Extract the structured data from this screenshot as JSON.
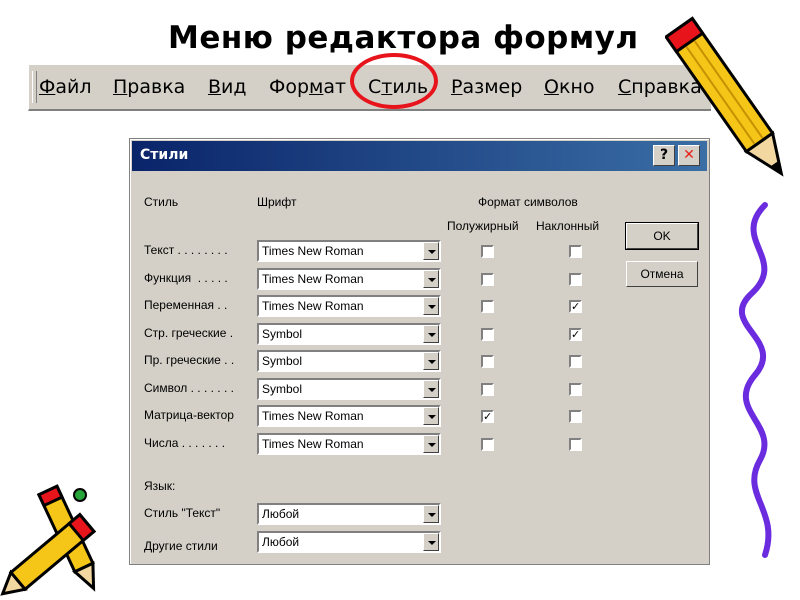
{
  "slide": {
    "title": "Меню редактора формул"
  },
  "menubar": {
    "items": [
      {
        "pre": "",
        "ul": "Ф",
        "post": "айл"
      },
      {
        "pre": "",
        "ul": "П",
        "post": "равка"
      },
      {
        "pre": "",
        "ul": "В",
        "post": "ид"
      },
      {
        "pre": "Фор",
        "ul": "м",
        "post": "ат"
      },
      {
        "pre": "С",
        "ul": "т",
        "post": "иль"
      },
      {
        "pre": "",
        "ul": "Р",
        "post": "азмер"
      },
      {
        "pre": "",
        "ul": "О",
        "post": "кно"
      },
      {
        "pre": "",
        "ul": "С",
        "post": "правка"
      }
    ],
    "highlight_color": "#e8141c"
  },
  "dialog": {
    "title": "Стили",
    "help_glyph": "?",
    "close_glyph": "✕",
    "headers": {
      "style": "Стиль",
      "font": "Шрифт",
      "char_format": "Формат символов",
      "bold": "Полужирный",
      "italic": "Наклонный"
    },
    "rows": [
      {
        "label": "Текст . . . . . . . .",
        "font": "Times New Roman",
        "bold": false,
        "italic": false
      },
      {
        "label": "Функция  . . . . .",
        "font": "Times New Roman",
        "bold": false,
        "italic": false
      },
      {
        "label": "Переменная . .",
        "font": "Times New Roman",
        "bold": false,
        "italic": true
      },
      {
        "label": "Стр. греческие .",
        "font": "Symbol",
        "bold": false,
        "italic": true
      },
      {
        "label": "Пр. греческие . .",
        "font": "Symbol",
        "bold": false,
        "italic": false
      },
      {
        "label": "Символ . . . . . . .",
        "font": "Symbol",
        "bold": false,
        "italic": false
      },
      {
        "label": "Матрица-вектор",
        "font": "Times New Roman",
        "bold": true,
        "italic": false
      },
      {
        "label": "Числа . . . . . . .",
        "font": "Times New Roman",
        "bold": false,
        "italic": false
      }
    ],
    "language": {
      "heading": "Язык:",
      "text_style_label": "Стиль \"Текст\"",
      "text_style_value": "Любой",
      "other_styles_label": "Другие стили",
      "other_styles_value": "Любой"
    },
    "buttons": {
      "ok": "OK",
      "cancel": "Отмена"
    },
    "colors": {
      "face": "#d4d0c8",
      "title_start": "#0a246a",
      "title_end": "#3a6ea5"
    }
  },
  "decorations": {
    "pencil_icon_colors": {
      "body": "#f5c518",
      "tip": "#e8141c",
      "outline": "#000000"
    },
    "squiggle_color": "#6b2ce0"
  }
}
